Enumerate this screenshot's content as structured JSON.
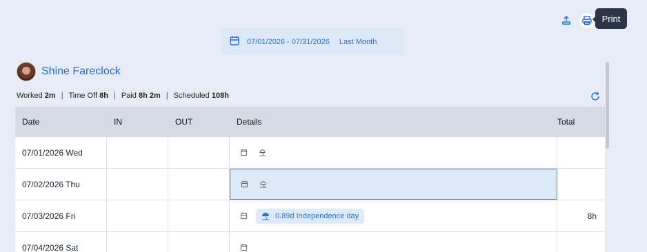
{
  "toolbar": {
    "tooltip": "Print"
  },
  "date_range": {
    "value": "07/01/2026 - 07/31/2026",
    "preset": "Last Month"
  },
  "employee": {
    "name": "Shine Fareclock"
  },
  "summary": {
    "worked_label": "Worked",
    "worked_value": "2m",
    "timeoff_label": "Time Off",
    "timeoff_value": "8h",
    "paid_label": "Paid",
    "paid_value": "8h 2m",
    "scheduled_label": "Scheduled",
    "scheduled_value": "108h"
  },
  "table": {
    "headers": {
      "date": "Date",
      "in": "IN",
      "out": "OUT",
      "details": "Details",
      "total": "Total"
    },
    "rows": [
      {
        "date": "07/01/2026 Wed",
        "in": "",
        "out": "",
        "timeoff": "",
        "total": ""
      },
      {
        "date": "07/02/2026 Thu",
        "in": "",
        "out": "",
        "timeoff": "",
        "total": ""
      },
      {
        "date": "07/03/2026 Fri",
        "in": "",
        "out": "",
        "timeoff": "0.89d Independence day",
        "total": "8h"
      },
      {
        "date": "07/04/2026 Sat",
        "in": "",
        "out": "",
        "timeoff": "",
        "total": ""
      }
    ]
  },
  "colors": {
    "accent": "#2a6fd6",
    "background": "#e7ebf3",
    "header": "#d5dae3",
    "selected": "#dceaf8"
  }
}
